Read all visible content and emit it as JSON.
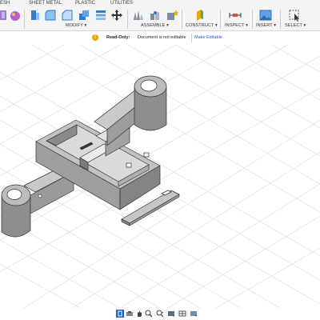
{
  "toolbar": {
    "tabs": [
      "ESH",
      "SHEET METAL",
      "PLASTIC",
      "UTILITIES"
    ],
    "groups": {
      "modify": "MODIFY ▾",
      "assemble": "ASSEMBLE ▾",
      "construct": "CONSTRUCT ▾",
      "inspect": "INSPECT ▾",
      "insert": "INSERT ▾",
      "select": "SELECT ▾"
    }
  },
  "readonly": {
    "label": "Read-Only:",
    "message": "Document is not editable",
    "button": "Make Editable"
  },
  "colors": {
    "accent": "#1a64c8",
    "model_face": "#a9a9a9",
    "model_dark": "#6e6e6e",
    "model_light": "#c8c8c8"
  },
  "icons": {
    "readonly": "warning-icon"
  }
}
